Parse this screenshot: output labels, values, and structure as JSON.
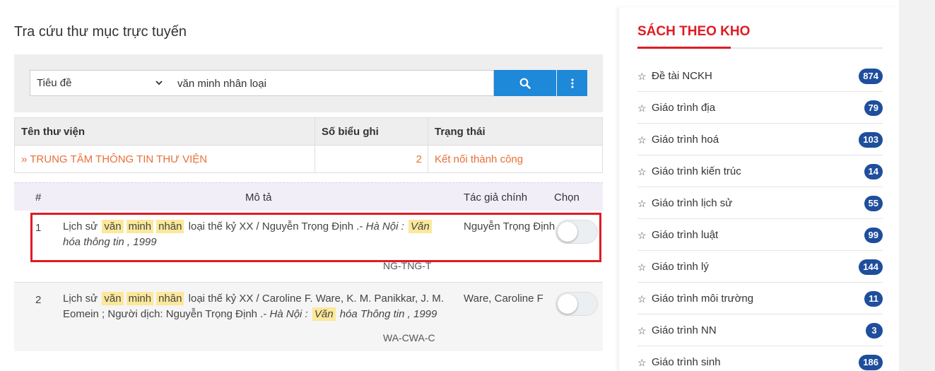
{
  "page": {
    "title": "Tra cứu thư mục trực tuyến"
  },
  "search": {
    "field_selected": "Tiêu đề",
    "query": "văn minh nhân loại"
  },
  "library_table": {
    "headers": [
      "Tên thư viện",
      "Số biểu ghi",
      "Trạng thái"
    ],
    "rows": [
      {
        "name": "TRUNG TÂM THÔNG TIN THƯ VIỆN",
        "count": "2",
        "status": "Kết nối thành công"
      }
    ]
  },
  "results": {
    "headers": {
      "index": "#",
      "description": "Mô tả",
      "author": "Tác giả chính",
      "select": "Chọn"
    },
    "items": [
      {
        "index": "1",
        "desc": {
          "p1": "Lịch sử",
          "h1": "văn",
          "h2": "minh",
          "h3": "nhân",
          "p2": "loại thế kỷ XX / Nguyễn Trọng Định .-",
          "pub1": "Hà Nội :",
          "h4": "Văn",
          "pub2": "hóa thông tin , 1999"
        },
        "author": "Nguyễn Trọng Định",
        "code": "NG-TNG-T",
        "selected": false
      },
      {
        "index": "2",
        "desc": {
          "p1": "Lịch sử",
          "h1": "văn",
          "h2": "minh",
          "h3": "nhân",
          "p2": "loại thế kỷ XX / Caroline F. Ware, K. M. Panikkar, J. M. Eomein ; Người dịch: Nguyễn Trọng Định .-",
          "pub1": "Hà Nội :",
          "h4": "Văn",
          "pub2": "hóa Thông tin , 1999"
        },
        "author": "Ware, Caroline F",
        "code": "WA-CWA-C",
        "selected": false
      }
    ]
  },
  "sidebar": {
    "title": "SÁCH THEO KHO",
    "items": [
      {
        "label": "Đề tài NCKH",
        "count": "874"
      },
      {
        "label": "Giáo trình địa",
        "count": "79"
      },
      {
        "label": "Giáo trình hoá",
        "count": "103"
      },
      {
        "label": "Giáo trình kiến trúc",
        "count": "14"
      },
      {
        "label": "Giáo trình lịch sử",
        "count": "55"
      },
      {
        "label": "Giáo trình luật",
        "count": "99"
      },
      {
        "label": "Giáo trình lý",
        "count": "144"
      },
      {
        "label": "Giáo trình môi trường",
        "count": "11"
      },
      {
        "label": "Giáo trình NN",
        "count": "3"
      },
      {
        "label": "Giáo trình sinh",
        "count": "186"
      }
    ]
  },
  "colors": {
    "accent": "#1e88d9",
    "brand_red": "#e01b24",
    "link_orange": "#e8703a",
    "badge": "#1e4e9c",
    "highlight": "#fbe89a"
  },
  "icons": {
    "search": "search-icon",
    "more": "vertical-dots-icon",
    "dropdown": "chevron-down-icon",
    "star": "star-outline-icon"
  }
}
